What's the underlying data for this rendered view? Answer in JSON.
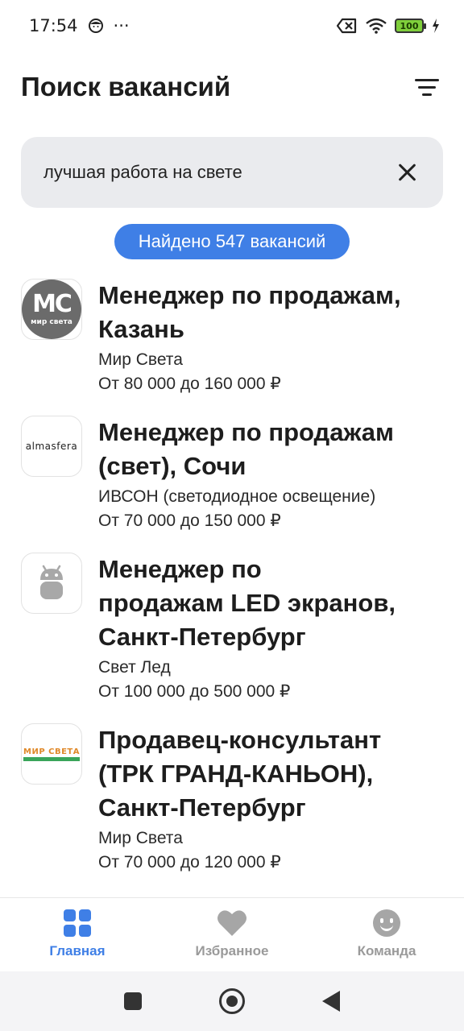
{
  "status_bar": {
    "time": "17:54",
    "more": "···",
    "battery": "100"
  },
  "header": {
    "title": "Поиск вакансий",
    "filter_icon": "filter-lines-icon"
  },
  "search": {
    "value": "лучшая работа на свете",
    "clear_icon": "close-icon"
  },
  "found_badge": "Найдено 547 вакансий",
  "jobs": [
    {
      "title_line1": "Менеджер по продажам,",
      "title_line2": "Казань",
      "title_line3": "",
      "company": "Мир Света",
      "salary": "От 80 000 до 160 000 ₽",
      "logo": {
        "mc": "МС",
        "sub": "мир света"
      }
    },
    {
      "title_line1": "Менеджер по продажам",
      "title_line2": "(свет), Сочи",
      "title_line3": "",
      "company": "ИВСОН (светодиодное освещение)",
      "salary": "От 70 000 до 150 000 ₽",
      "logo": {
        "text": "almasfera"
      }
    },
    {
      "title_line1": "Менеджер по",
      "title_line2": "продажам LED экранов,",
      "title_line3": "Санкт-Петербург",
      "company": "Свет Лед",
      "salary": "От 100 000 до 500 000 ₽",
      "logo": {
        "icon": "android-icon"
      }
    },
    {
      "title_line1": "Продавец-консультант",
      "title_line2": "(ТРК ГРАНД-КАНЬОН),",
      "title_line3": "Санкт-Петербург",
      "company": "Мир Света",
      "salary": "От 70 000 до 120 000 ₽",
      "logo": {
        "text": "МИР СВЕТА"
      }
    }
  ],
  "bottom_nav": [
    {
      "label": "Главная",
      "icon": "grid-icon",
      "active": true
    },
    {
      "label": "Избранное",
      "icon": "heart-icon",
      "active": false
    },
    {
      "label": "Команда",
      "icon": "smile-icon",
      "active": false
    }
  ],
  "colors": {
    "accent": "#3f7fe6",
    "search_bg": "#eaebee",
    "inactive": "#9a9a9a"
  }
}
